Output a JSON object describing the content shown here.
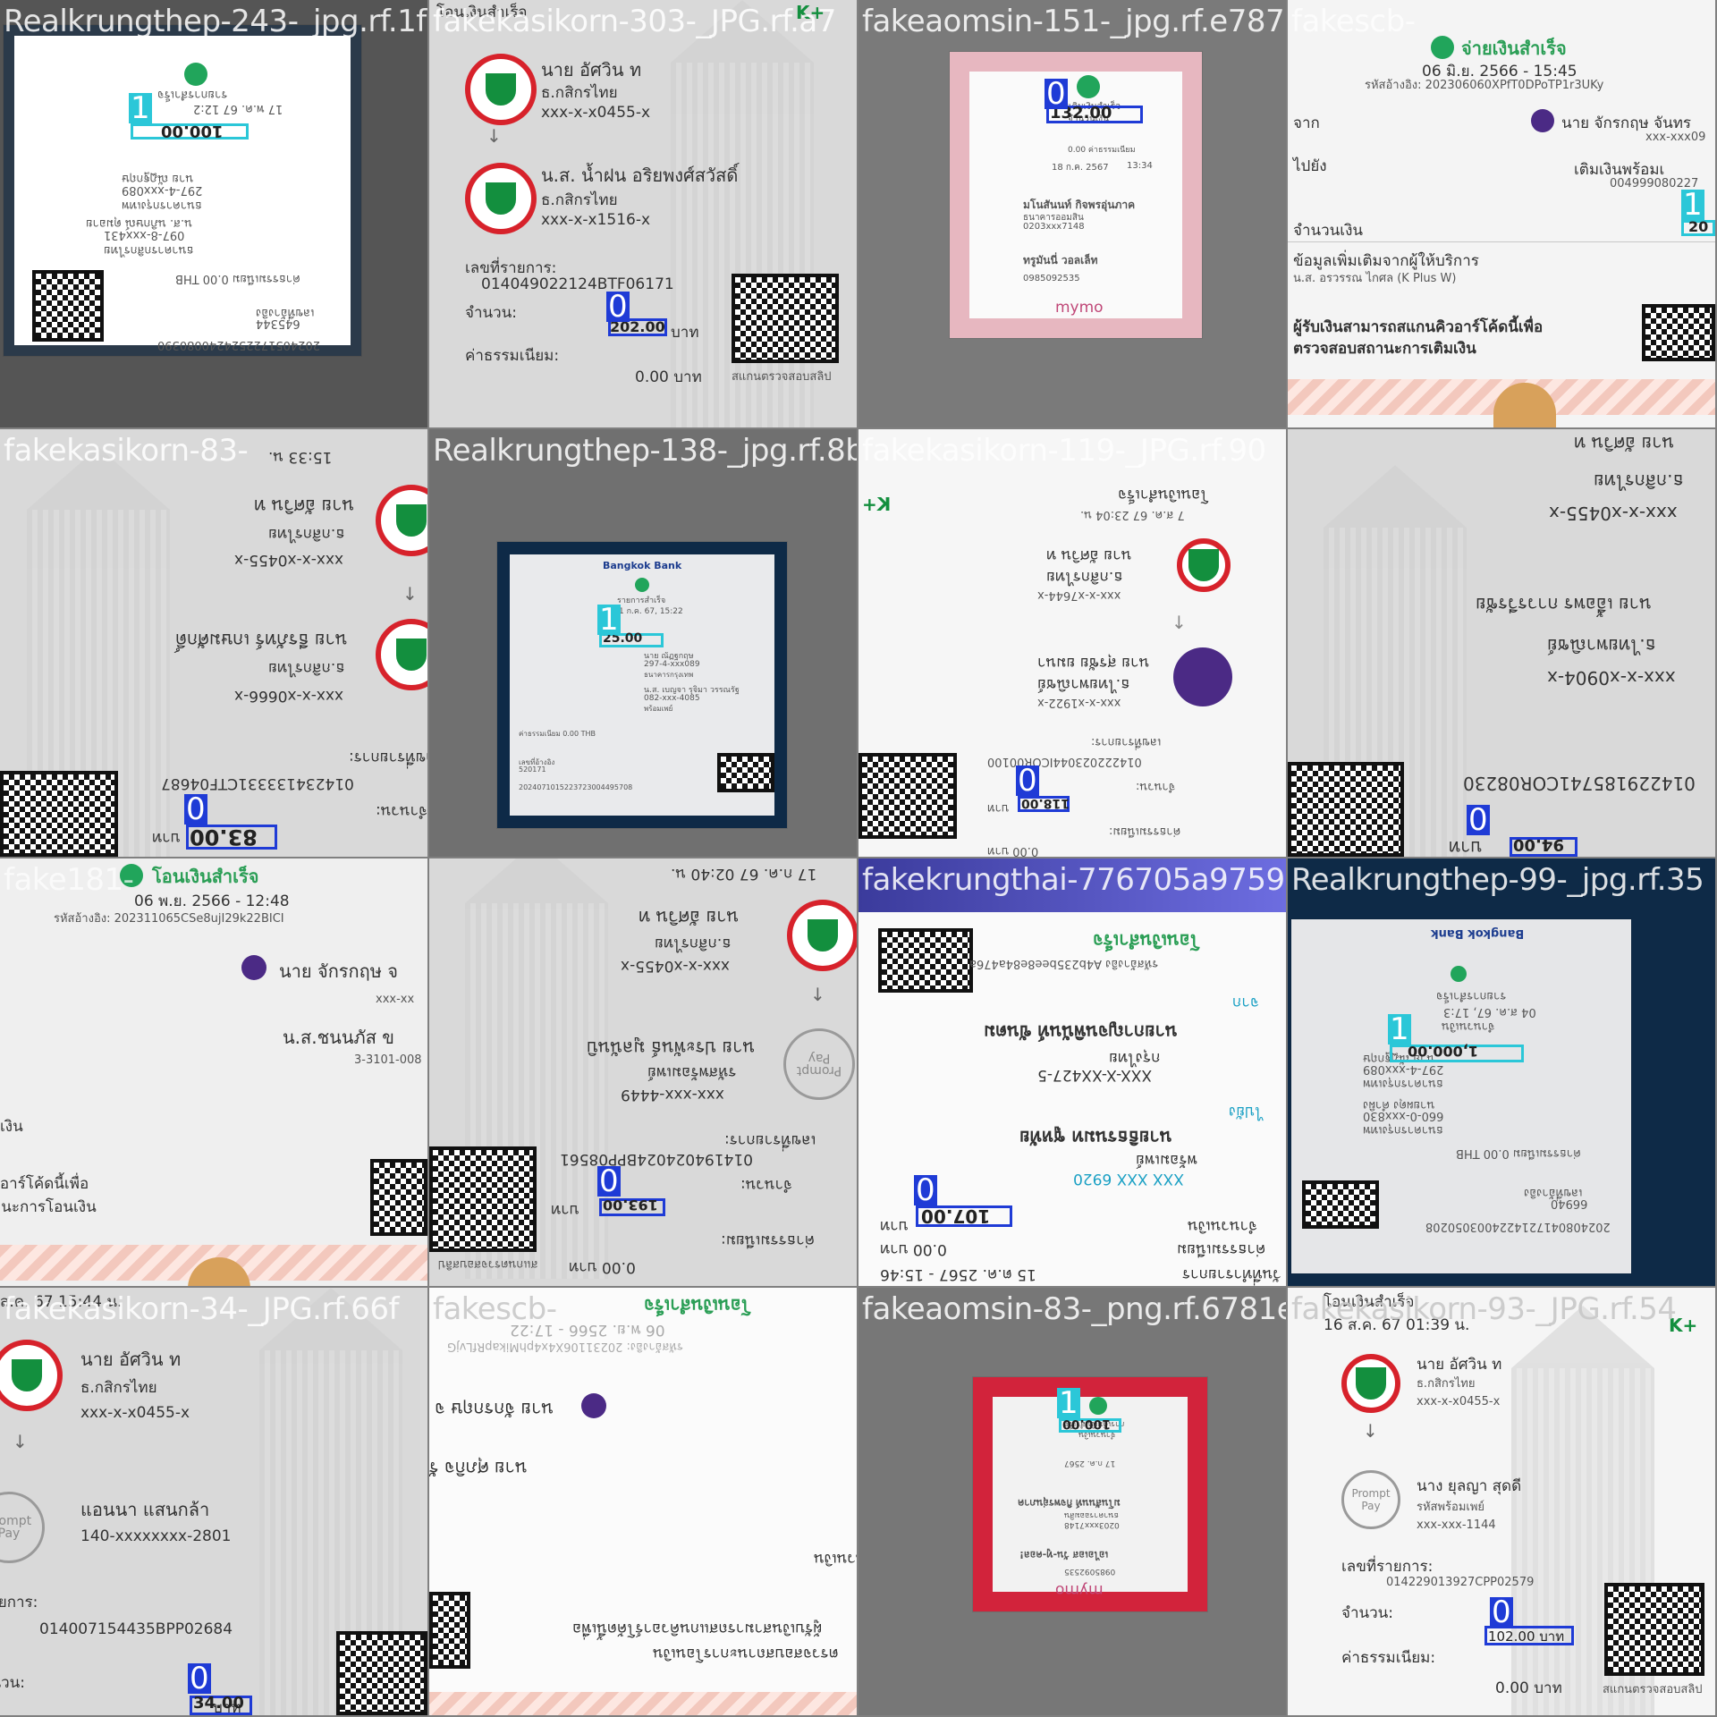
{
  "tiles": [
    {
      "file": "Realkrungthep-243-_jpg.rf.1f",
      "lines": [
        "รายการสำเร็จ",
        "17 พ.ค. 67 12:2",
        "100.00 THB",
        "นาย ณัฏฐกฤษ",
        "297-4-xxx089",
        "ธนาคารกรุงเทพ",
        "น.ส. นภิกษณ์ ดุมอาย",
        "097-8-xxx431",
        "ธนาคารกสิกรไทย",
        "ค่าธรรมเนียม 0.00 THB",
        "เลขที่อ้างอิง",
        "645344",
        "2024051722524240080390"
      ],
      "boxes": [
        {
          "label": "1",
          "value": "100.00"
        }
      ]
    },
    {
      "file": "fakekasikorn-303-_JPG.rf.a7",
      "lines": [
        "โอนเงินสำเร็จ",
        "นาย อัศวิน ท",
        "ธ.กสิกรไทย",
        "xxx-x-x0455-x",
        "น.ส. น้ำฝน อริยพงศ์สวัสดิ์",
        "ธ.กสิกรไทย",
        "xxx-x-x1516-x",
        "เลขที่รายการ:",
        "014049022124BTF06171",
        "จำนวน:",
        "บาท",
        "ค่าธรรมเนียม:",
        "0.00 บาท",
        "สแกนตรวจสอบสลิป"
      ],
      "boxes": [
        {
          "label": "0",
          "value": "202.00"
        }
      ]
    },
    {
      "file": "fakeaomsin-151-_jpg.rf.e787",
      "lines": [
        "การเติมเงินสำเร็จ",
        "จำนวนเงิน",
        "132.00",
        "0.00 ค่าธรรมเนียม",
        "มโนสันนท์ กิจพรอุ่นภาค",
        "ธนาคารออมสิน",
        "0203xxx7148",
        "ทรูมันนี่ วอลเล็ท",
        "0985092535",
        "18 ก.ค. 2567",
        "13:34"
      ],
      "boxes": [
        {
          "label": "0",
          "value": "132.00"
        }
      ]
    },
    {
      "file": "fakescb-",
      "lines": [
        "จ่ายเงินสำเร็จ",
        "06 มิ.ย. 2566 - 15:45",
        "รหัสอ้างอิง: 202306060XPfT0DPoTP1r3UKy",
        "จาก",
        "นาย จักรกฤษ จันทร",
        "xxx-xxx09",
        "ไปยัง",
        "เติมเงินพร้อมเ",
        "004999080227",
        "จำนวนเงิน",
        "ข้อมูลเพิ่มเติมจากผู้ให้บริการ",
        "น.ส. อรวรรณ ไกศล (K Plus W)",
        "ผู้รับเงินสามารถสแกนคิวอาร์โค้ดนี้เพื่อ",
        "ตรวจสอบสถานะการเติมเงิน"
      ],
      "boxes": [
        {
          "label": "1",
          "value": "20"
        }
      ]
    },
    {
      "file": "fakekasikorn-83-",
      "lines": [
        "นาย อัศวิน ท",
        "ธ.กสิกรไทย",
        "xxx-x-x0455-x",
        "นาย ธีรภัทร์ เกษมศักดิ์",
        "ธ.กสิกรไทย",
        "xxx-x-x0666-x",
        "เลขที่รายการ:",
        "014234133331CTF04687",
        "จำนวน:",
        "บาท",
        "15:33 น."
      ],
      "boxes": [
        {
          "label": "0",
          "value": "83.00"
        }
      ]
    },
    {
      "file": "Realkrungthep-138-_jpg.rf.8b",
      "lines": [
        "Bangkok Bank",
        "รายการสำเร็จ",
        "1 ก.ค. 67, 15:22",
        "25.00 THB",
        "นาย ณัฏฐกฤษ",
        "297-4-xxx089",
        "ธนาคารกรุงเทพ",
        "น.ส. เบญจา รุจิมา วรรณรัฐ",
        "082-xxx-4085",
        "พร้อมเพย์",
        "ค่าธรรมเนียม 0.00 THB",
        "เลขที่อ้างอิง",
        "520171",
        "2024071015223723004495708",
        "สแกนตรวจสอบ"
      ],
      "boxes": [
        {
          "label": "1",
          "value": "25.00"
        }
      ]
    },
    {
      "file": "fakekasikorn-119-_JPG.rf.90",
      "lines": [
        "โอนเงินสำเร็จ",
        "7 ส.ค. 67 23:04 น.",
        "นาย อัศวิน ท",
        "ธ.กสิกรไทย",
        "xxx-x-x7644-x",
        "นาย สุรชัย ยมนา",
        "ธ.ไทยพาณิชย์",
        "xxx-x-x1922-x",
        "เลขที่รายการ:",
        "014222023044ICOR00100",
        "จำนวน:",
        "บาท",
        "ค่าธรรมเนียม:",
        "0.00 บาท",
        "สแกนตรวจสอบสลิป"
      ],
      "boxes": [
        {
          "label": "0",
          "value": "118.00"
        }
      ]
    },
    {
      "file": "",
      "lines": [
        "นาย อัศวิน ท",
        "ธ.กสิกรไทย",
        "xxx-x-x0455-x",
        "นาย เอื้อพร กาวรวีรชัย",
        "ธ.ไทยพาณิชย์",
        "xxx-x-x0904-x",
        "014229185741COR08230",
        "บาท"
      ],
      "boxes": [
        {
          "label": "0",
          "value": "94.00"
        }
      ]
    },
    {
      "file": "fake181-",
      "lines": [
        "โอนเงินสำเร็จ",
        "06 พ.ย. 2566 - 12:48",
        "รหัสอ้างอิง: 202311065CSe8ujI29k22BICI",
        "นาย จักรกฤษ จ",
        "xxx-xx",
        "น.ส.ชนนภัส ข",
        "3-3101-008",
        "เงิน",
        "ผู้รับเงินสามารถสแกนคิวอาร์โค้ดนี้เพื่อ",
        "ตรวจสอบสถานะการโอนเงิน"
      ],
      "boxes": []
    },
    {
      "file": "",
      "lines": [
        "นาย อัศวิน ท",
        "ธ.กสิกรไทย",
        "xxx-x-x0455-x",
        "นาย ประพันธ์ มูลนันบิ",
        "รหัสพร้อมเพย์",
        "xxx-xxx-4449",
        "เลขที่รายการ:",
        "014194024024BPP08561",
        "จำนวน:",
        "บาท",
        "ค่าธรรมเนียม:",
        "0.00 บาท",
        "สแกนตรวจสอบสลิป",
        "17 ก.ค. 67 02:40 น."
      ],
      "boxes": [
        {
          "label": "0",
          "value": "193.00"
        }
      ]
    },
    {
      "file": "fakekrungthai-776705a9759e3",
      "lines": [
        "โอนเงินสำเร็จ",
        "รหัสอ้างอิง A4b235bee8e84a476a",
        "จาก",
        "นายกาญจนพินันท์ ขันตม",
        "กรุงไทย",
        "XXX-X-XX427-5",
        "ไปยัง",
        "นายธิธรนมท ชูหทัย",
        "พร้อมเพย์",
        "XXX XXX 6920",
        "จำนวนเงิน",
        "บาท",
        "ค่าธรรมเนียม",
        "0.00 บาท",
        "วันที่ทำรายการ",
        "15 ต.ค. 2567 - 15:46"
      ],
      "boxes": [
        {
          "label": "0",
          "value": "107.00"
        }
      ]
    },
    {
      "file": "Realkrungthep-99-_jpg.rf.35",
      "lines": [
        "Bangkok Bank",
        "รายการสำเร็จ",
        "04 ส.ค. 67, 17:3",
        "จำนวนเงิน",
        "1,000.00 THB",
        "นาย ณัฏฐกฤษ",
        "297-4-xxx089",
        "ธนาคารกรุงเทพ",
        "นายผดุง คำผิง",
        "660-0-xxx830",
        "ธนาคารกรุงเทพ",
        "ค่าธรรมเนียม 0.00 THB",
        "เลขที่อ้างอิง",
        "66940",
        "2024080417214224003050208"
      ],
      "boxes": [
        {
          "label": "1",
          "value": "1,000.00"
        }
      ]
    },
    {
      "file": "fakekasikorn-34-_JPG.rf.66f",
      "lines": [
        "ส.ค. 67 15:44 น.",
        "นาย อัศวิน ท",
        "ธ.กสิกรไทย",
        "xxx-x-x0455-x",
        "แอนนา แสนกล้า",
        "140-xxxxxxxx-2801",
        "เลขที่รายการ:",
        "014007154435BPP02684",
        "จำนวน:",
        "บาท"
      ],
      "boxes": [
        {
          "label": "0",
          "value": "34.00"
        }
      ]
    },
    {
      "file": "fakescb-",
      "lines": [
        "โอนเงินสำเร็จ",
        "06 พ.ย. 2566 - 17:22",
        "รหัสอ้างอิง: 20231106X4x4phMikapRfLvjG",
        "นาย จักรกฤษ จ",
        "นาย ศุภกิจ รัง",
        "จำนวนเงิน",
        "ผู้รับเงินสามารถสแกนคิวอาร์โค้ดนี้เพื่อ",
        "ตรวจสอบสถานะการโอนเงิน"
      ],
      "boxes": []
    },
    {
      "file": "fakeaomsin-83-_png.rf.6781e",
      "lines": [
        "การเติมเงินสำเร็จ",
        "จำนวนเงิน",
        "100.00",
        "17 ก.ค. 2567",
        "มโนสันนท์ กิจพรอุ่นภาค",
        "ธนาคารออมสิน",
        "0203xxx7148",
        "เอไอเอส วัน-ทู-คอล!",
        "0985092535"
      ],
      "boxes": [
        {
          "label": "1",
          "value": "100.00"
        }
      ]
    },
    {
      "file": "fakekasikorn-93-_JPG.rf.54",
      "lines": [
        "โอนเงินสำเร็จ",
        "16 ส.ค. 67 01:39 น.",
        "นาย อัศวิน ท",
        "ธ.กสิกรไทย",
        "xxx-x-x0455-x",
        "นาง ยุลญา สุดดี",
        "รหัสพร้อมเพย์",
        "xxx-xxx-1144",
        "เลขที่รายการ:",
        "014229013927CPP02579",
        "จำนวน:",
        "ค่าธรรมเนียม:",
        "0.00 บาท",
        "สแกนตรวจสอบสลิป"
      ],
      "boxes": [
        {
          "label": "0",
          "value": "102.00 บาท"
        }
      ]
    }
  ],
  "logos": {
    "kplus": "K+",
    "promptpay": "Prompt Pay",
    "mymo": "mymo",
    "bangkok_bank": "Bangkok Bank"
  },
  "colors": {
    "box_class0": "#1f3bd6",
    "box_class1": "#2bc7d8",
    "kbank_green": "#138f3e",
    "kbank_red": "#d7222b",
    "scb_purple": "#4b2a85"
  }
}
